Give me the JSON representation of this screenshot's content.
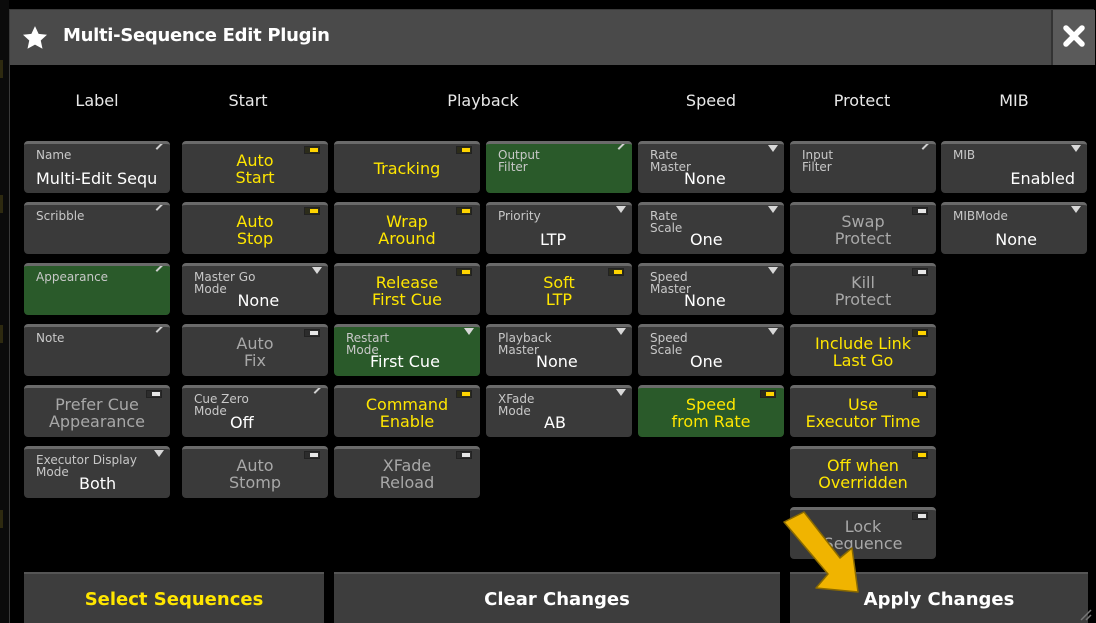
{
  "window": {
    "title": "Multi-Sequence Edit Plugin",
    "close_icon": "close-x-icon",
    "title_icon": "star-icon"
  },
  "columns": {
    "label": "Label",
    "start": "Start",
    "playback": "Playback",
    "speed": "Speed",
    "protect": "Protect",
    "mib": "MIB"
  },
  "label": {
    "name": {
      "small": "Name",
      "value": "Multi-Edit Sequ"
    },
    "scribble": {
      "small": "Scribble"
    },
    "appearance": {
      "small": "Appearance"
    },
    "note": {
      "small": "Note"
    },
    "prefer_cue": {
      "line1": "Prefer Cue",
      "line2": "Appearance"
    },
    "exec_display": {
      "small1": "Executor Display",
      "small2": "Mode",
      "value": "Both"
    }
  },
  "start": {
    "auto_start": {
      "line1": "Auto",
      "line2": "Start"
    },
    "auto_stop": {
      "line1": "Auto",
      "line2": "Stop"
    },
    "master_go": {
      "small1": "Master Go",
      "small2": "Mode",
      "value": "None"
    },
    "auto_fix": {
      "line1": "Auto",
      "line2": "Fix"
    },
    "cue_zero": {
      "small1": "Cue Zero",
      "small2": "Mode",
      "value": "Off"
    },
    "auto_stomp": {
      "line1": "Auto",
      "line2": "Stomp"
    }
  },
  "playback1": {
    "tracking": {
      "line1": "Tracking"
    },
    "wrap": {
      "line1": "Wrap",
      "line2": "Around"
    },
    "release": {
      "line1": "Release",
      "line2": "First Cue"
    },
    "restart": {
      "small1": "Restart",
      "small2": "Mode",
      "value": "First Cue"
    },
    "command": {
      "line1": "Command",
      "line2": "Enable"
    },
    "xfade_reload": {
      "line1": "XFade",
      "line2": "Reload"
    }
  },
  "playback2": {
    "output_filter": {
      "small1": "Output",
      "small2": "Filter"
    },
    "priority": {
      "small": "Priority",
      "value": "LTP"
    },
    "soft_ltp": {
      "line1": "Soft",
      "line2": "LTP"
    },
    "playback_master": {
      "small1": "Playback",
      "small2": "Master",
      "value": "None"
    },
    "xfade_mode": {
      "small1": "XFade",
      "small2": "Mode",
      "value": "AB"
    }
  },
  "speed": {
    "rate_master": {
      "small1": "Rate",
      "small2": "Master",
      "value": "None"
    },
    "rate_scale": {
      "small1": "Rate",
      "small2": "Scale",
      "value": "One"
    },
    "speed_master": {
      "small1": "Speed",
      "small2": "Master",
      "value": "None"
    },
    "speed_scale": {
      "small1": "Speed",
      "small2": "Scale",
      "value": "One"
    },
    "speed_from_rate": {
      "line1": "Speed",
      "line2": "from Rate"
    }
  },
  "protect": {
    "input_filter": {
      "small1": "Input",
      "small2": "Filter"
    },
    "swap": {
      "line1": "Swap",
      "line2": "Protect"
    },
    "kill": {
      "line1": "Kill",
      "line2": "Protect"
    },
    "include_link": {
      "line1": "Include Link",
      "line2": "Last Go"
    },
    "use_exec_time": {
      "line1": "Use",
      "line2": "Executor Time"
    },
    "off_overridden": {
      "line1": "Off when",
      "line2": "Overridden"
    },
    "lock_sequence": {
      "line1": "Lock",
      "line2": "Sequence"
    }
  },
  "mib": {
    "mib": {
      "small": "MIB",
      "value": "Enabled"
    },
    "mib_mode": {
      "small": "MIBMode",
      "value": "None"
    }
  },
  "bottom": {
    "select": "Select Sequences",
    "clear": "Clear Changes",
    "apply": "Apply Changes"
  },
  "colors": {
    "yellow": "#ffe600",
    "green_button": "#2a5a2a",
    "button_grey": "#3a3a3a",
    "titlebar": "#4a4a4a",
    "arrow": "#f0b400"
  }
}
